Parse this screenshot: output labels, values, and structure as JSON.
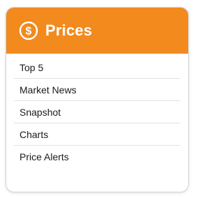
{
  "colors": {
    "accent": "#f28a1e",
    "header_text": "#ffffff",
    "item_text": "#1a1a1a",
    "divider": "#e2e2e2"
  },
  "header": {
    "icon": "dollar-coin-icon",
    "title": "Prices"
  },
  "menu": {
    "items": [
      {
        "label": "Top 5"
      },
      {
        "label": "Market News"
      },
      {
        "label": "Snapshot"
      },
      {
        "label": "Charts"
      },
      {
        "label": "Price Alerts"
      }
    ]
  }
}
